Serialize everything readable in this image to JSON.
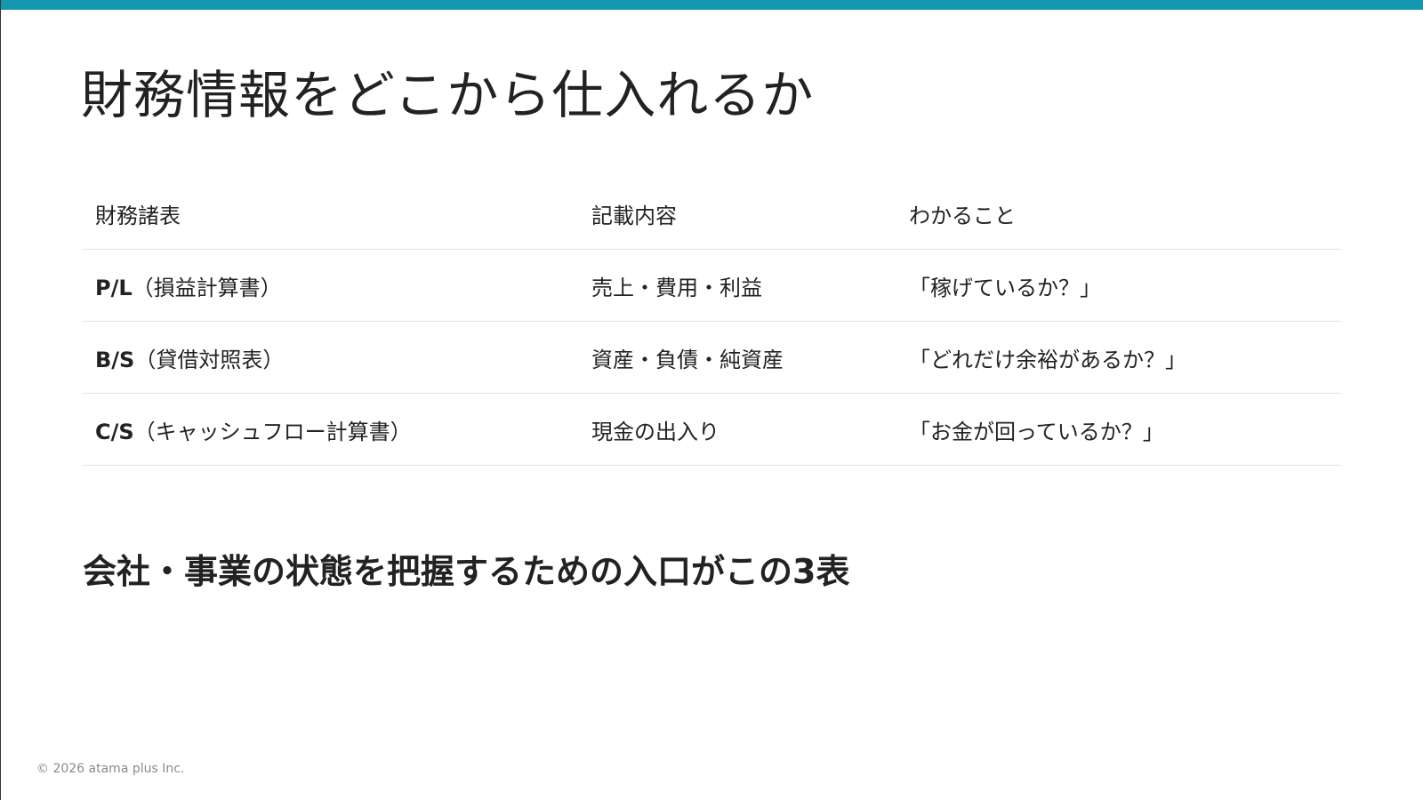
{
  "colors": {
    "accent_bar": "#1597b0",
    "text": "#222222",
    "divider": "#e6e6e6",
    "footer_text": "#8a8a8a"
  },
  "slide": {
    "title": "財務情報をどこから仕入れるか",
    "table": {
      "headers": [
        "財務諸表",
        "記載内容",
        "わかること"
      ],
      "rows": [
        {
          "code": "P/L",
          "name": "（損益計算書）",
          "content": "売上・費用・利益",
          "insight": "「稼げているか？」"
        },
        {
          "code": "B/S",
          "name": "（貸借対照表）",
          "content": "資産・負債・純資産",
          "insight": "「どれだけ余裕があるか？」"
        },
        {
          "code": "C/S",
          "name": "（キャッシュフロー計算書）",
          "content": "現金の出入り",
          "insight": "「お金が回っているか？」"
        }
      ]
    },
    "conclusion": "会社・事業の状態を把握するための入口がこの3表",
    "footer": "© 2026 atama plus Inc."
  }
}
